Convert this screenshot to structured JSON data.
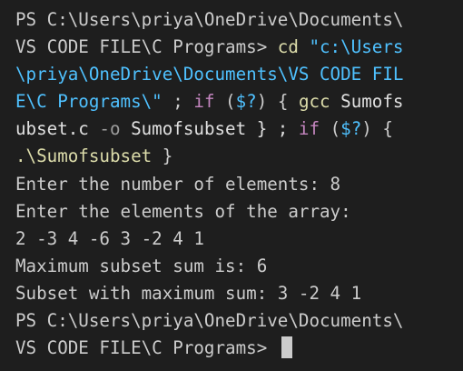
{
  "terminal": {
    "lines": [
      [
        {
          "t": "PS C:\\Users\\priya\\OneDrive\\Documents\\",
          "c": "c-default"
        }
      ],
      [
        {
          "t": "VS CODE FILE\\C Programs> ",
          "c": "c-default"
        },
        {
          "t": "cd",
          "c": "c-yellow"
        },
        {
          "t": " \"c:\\Users",
          "c": "c-string"
        }
      ],
      [
        {
          "t": "\\priya\\OneDrive\\Documents\\VS CODE FIL",
          "c": "c-string"
        }
      ],
      [
        {
          "t": "E\\C Programs\\\"",
          "c": "c-string"
        },
        {
          "t": " ; ",
          "c": "c-default"
        },
        {
          "t": "if",
          "c": "c-purple"
        },
        {
          "t": " (",
          "c": "c-default"
        },
        {
          "t": "$?",
          "c": "c-string"
        },
        {
          "t": ") { ",
          "c": "c-default"
        },
        {
          "t": "gcc",
          "c": "c-yellow"
        },
        {
          "t": " Sumofs",
          "c": "c-white"
        }
      ],
      [
        {
          "t": "ubset.c",
          "c": "c-white"
        },
        {
          "t": " -o",
          "c": "c-gray"
        },
        {
          "t": " Sumofsubset } ; ",
          "c": "c-white"
        },
        {
          "t": "if",
          "c": "c-purple"
        },
        {
          "t": " (",
          "c": "c-default"
        },
        {
          "t": "$?",
          "c": "c-string"
        },
        {
          "t": ") {",
          "c": "c-default"
        }
      ],
      [
        {
          "t": ".\\Sumofsubset",
          "c": "c-yellow"
        },
        {
          "t": " }",
          "c": "c-default"
        }
      ],
      [
        {
          "t": "Enter the number of elements: 8",
          "c": "c-default"
        }
      ],
      [
        {
          "t": "Enter the elements of the array:",
          "c": "c-default"
        }
      ],
      [
        {
          "t": "2 -3 4 -6 3 -2 4 1",
          "c": "c-default"
        }
      ],
      [
        {
          "t": "Maximum subset sum is: 6",
          "c": "c-default"
        }
      ],
      [
        {
          "t": "Subset with maximum sum: 3 -2 4 1",
          "c": "c-default"
        }
      ],
      [
        {
          "t": "PS C:\\Users\\priya\\OneDrive\\Documents\\",
          "c": "c-default"
        }
      ],
      [
        {
          "t": "VS CODE FILE\\C Programs> ",
          "c": "c-default"
        }
      ]
    ],
    "colors": {
      "background": "#1e1e1e",
      "text": "#cccccc",
      "command": "#dcdcaa",
      "string": "#4fc1ff",
      "keyword": "#c586c0",
      "flag": "#9d9d9d"
    }
  }
}
